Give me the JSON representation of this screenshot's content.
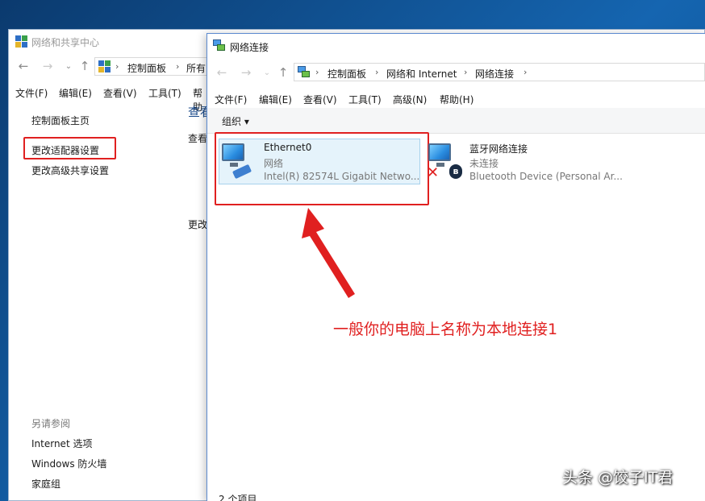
{
  "back_window": {
    "title": "网络和共享中心",
    "address": [
      "控制面板",
      "所有"
    ],
    "menu": [
      "文件(F)",
      "编辑(E)",
      "查看(V)",
      "工具(T)",
      "帮助"
    ],
    "sidebar": {
      "items": [
        "控制面板主页",
        "更改适配器设置",
        "更改高级共享设置"
      ],
      "see_also_title": "另请参阅",
      "see_also": [
        "Internet 选项",
        "Windows 防火墙",
        "家庭组"
      ]
    },
    "partial_main": [
      "查看",
      "查看",
      "更改"
    ]
  },
  "front_window": {
    "title": "网络连接",
    "address": [
      "控制面板",
      "网络和 Internet",
      "网络连接"
    ],
    "menu": [
      "文件(F)",
      "编辑(E)",
      "查看(V)",
      "工具(T)",
      "高级(N)",
      "帮助(H)"
    ],
    "organize": "组织 ▾",
    "connections": [
      {
        "name": "Ethernet0",
        "network": "网络",
        "device": "Intel(R) 82574L Gigabit Netwo..."
      },
      {
        "name": "蓝牙网络连接",
        "network": "未连接",
        "device": "Bluetooth Device (Personal Ar..."
      }
    ],
    "status_bar": "2 个项目"
  },
  "annotation": "一般你的电脑上名称为本地连接1",
  "watermark": "头条 @饺子IT君",
  "colors": {
    "highlight": "#e02020",
    "selection_fill": "#e5f3fb",
    "selection_border": "#a8d2ec",
    "desktop": "#1565b0"
  }
}
